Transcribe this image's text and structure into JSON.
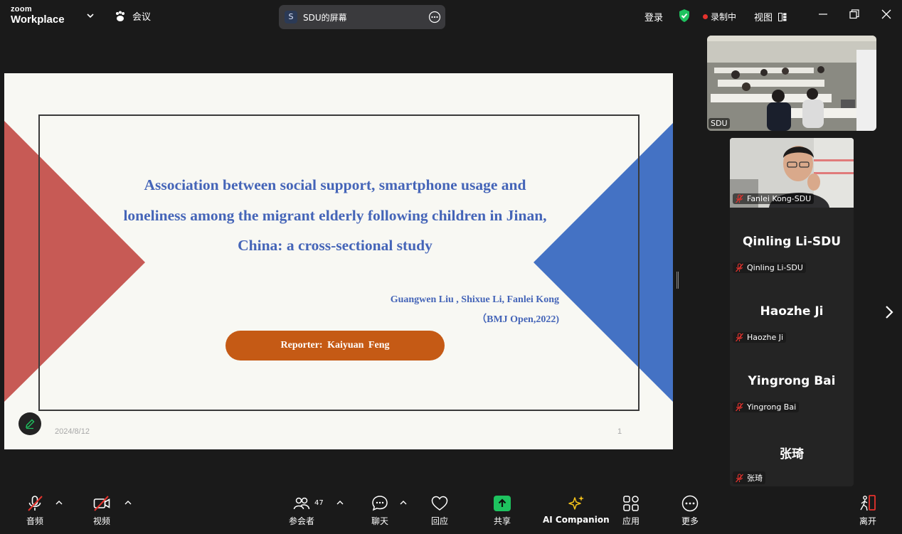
{
  "titlebar": {
    "brand_top": "zoom",
    "brand_bottom": "Workplace",
    "meeting_label": "会议",
    "share_initial": "S",
    "share_title": "SDU的屏幕",
    "signin": "登录",
    "recording": "录制中",
    "view": "视图"
  },
  "slide": {
    "title": "Association between social support, smartphone usage and loneliness among the migrant elderly following children in Jinan, China: a cross-sectional study",
    "authors": "Guangwen Liu , Shixue Li, Fanlei Kong",
    "journal": "（BMJ Open,2022)",
    "reporter": "Reporter:  Kaiyuan  Feng",
    "date": "2024/8/12",
    "page": "1"
  },
  "gallery": {
    "room_name": "SDU",
    "video_participant": "Fanlei Kong-SDU",
    "participants": [
      {
        "big": "Qinling Li-SDU",
        "small": "Qinling Li-SDU"
      },
      {
        "big": "Haozhe Ji",
        "small": "Haozhe Ji"
      },
      {
        "big": "Yingrong Bai",
        "small": "Yingrong Bai"
      },
      {
        "big": "张琦",
        "small": "张琦"
      }
    ]
  },
  "toolbar": {
    "audio": "音频",
    "video": "视频",
    "participants": "参会者",
    "participants_count": "47",
    "chat": "聊天",
    "react": "回应",
    "share": "共享",
    "ai": "AI Companion",
    "apps": "应用",
    "more": "更多",
    "leave": "离开"
  },
  "colors": {
    "slide_blue": "#4565b8",
    "slide_red": "#c75a55",
    "slide_triangle_blue": "#4472c4",
    "reporter_orange": "#c55a15",
    "share_green": "#1ec25f",
    "mute_red": "#e5322d"
  }
}
